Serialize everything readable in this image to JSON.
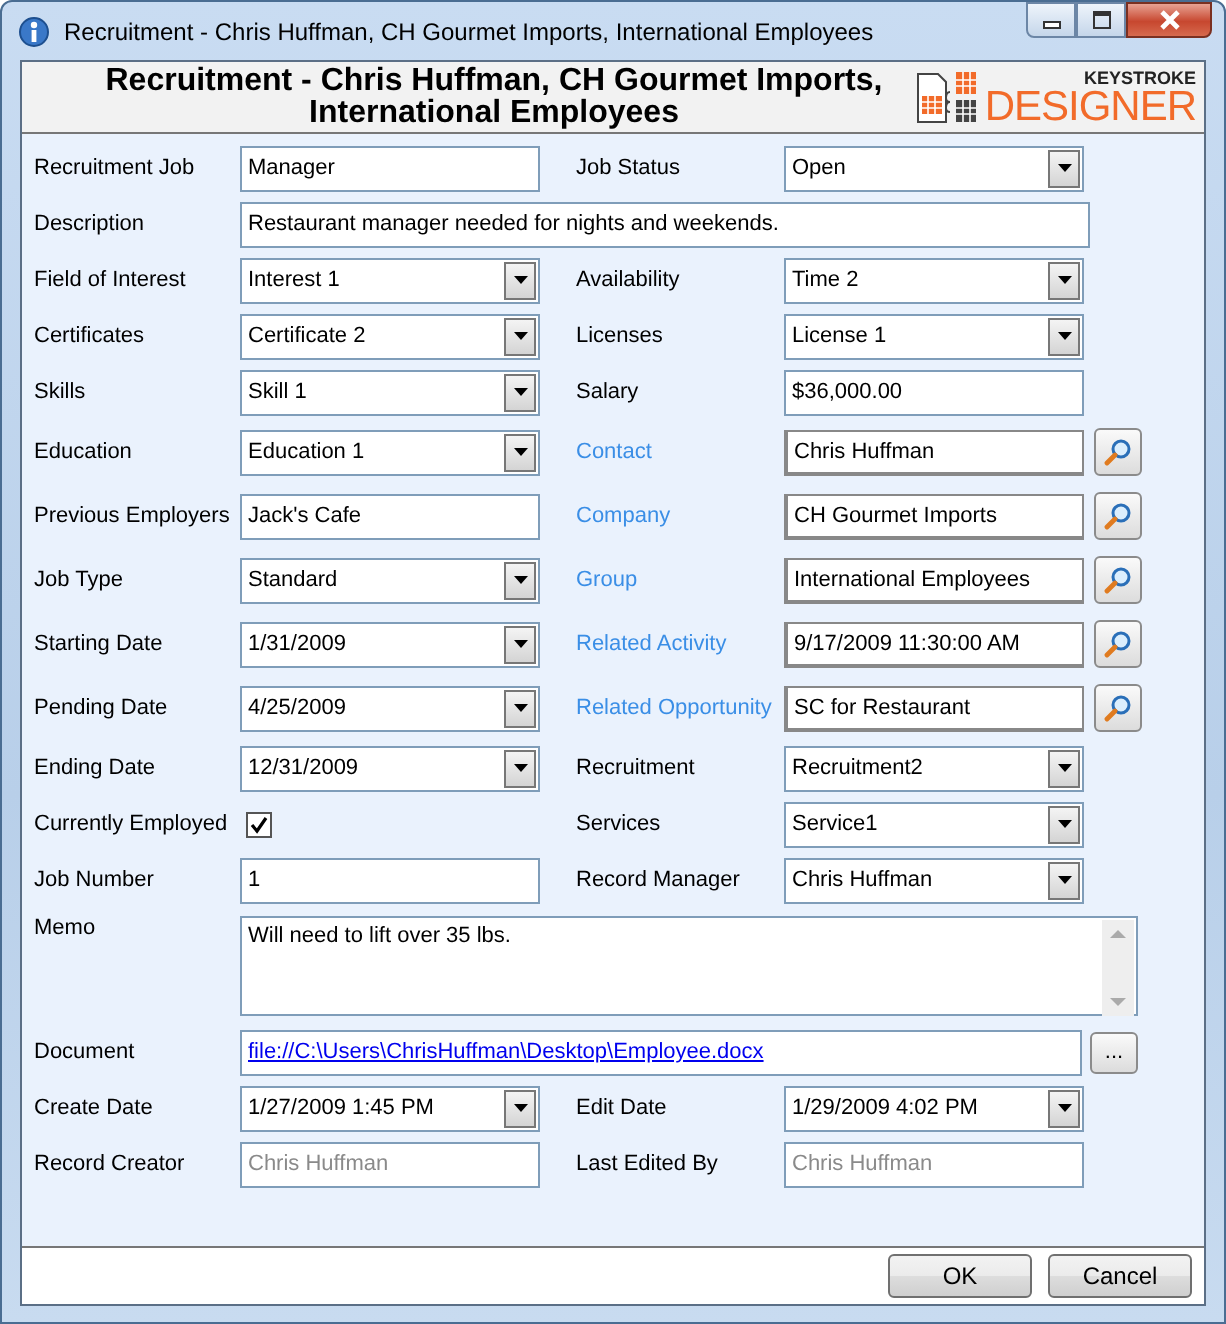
{
  "window": {
    "title": "Recruitment - Chris Huffman, CH Gourmet Imports, International Employees"
  },
  "header": {
    "title": "Recruitment - Chris Huffman, CH Gourmet Imports, International Employees",
    "logo_top": "KEYSTROKE",
    "logo_bottom": "DESIGNER"
  },
  "rows": [
    {
      "fields": [
        {
          "label": "Recruitment Job",
          "kind": "text",
          "value": "Manager"
        },
        {
          "label": "Job Status",
          "kind": "combo",
          "value": "Open"
        }
      ]
    },
    {
      "fields": [
        {
          "label": "Description",
          "kind": "text",
          "value": "Restaurant manager needed for nights and weekends."
        }
      ]
    },
    {
      "fields": [
        {
          "label": "Field of Interest",
          "kind": "combo",
          "value": "Interest 1"
        },
        {
          "label": "Availability",
          "kind": "combo",
          "value": "Time 2"
        }
      ]
    },
    {
      "fields": [
        {
          "label": "Certificates",
          "kind": "combo",
          "value": "Certificate 2"
        },
        {
          "label": "Licenses",
          "kind": "combo",
          "value": "License 1"
        }
      ]
    },
    {
      "fields": [
        {
          "label": "Skills",
          "kind": "combo",
          "value": "Skill 1"
        },
        {
          "label": "Salary",
          "kind": "text",
          "value": "$36,000.00"
        }
      ]
    },
    {
      "fields": [
        {
          "label": "Education",
          "kind": "combo",
          "value": "Education 1"
        },
        {
          "label": "Contact",
          "kind": "lookup",
          "value": "Chris Huffman"
        }
      ]
    },
    {
      "fields": [
        {
          "label": "Previous Employers",
          "kind": "text",
          "value": "Jack's Cafe"
        },
        {
          "label": "Company",
          "kind": "lookup",
          "value": "CH Gourmet Imports"
        }
      ]
    },
    {
      "fields": [
        {
          "label": "Job Type",
          "kind": "combo",
          "value": "Standard"
        },
        {
          "label": "Group",
          "kind": "lookup",
          "value": "International Employees"
        }
      ]
    },
    {
      "fields": [
        {
          "label": "Starting Date",
          "kind": "combo",
          "value": "1/31/2009"
        },
        {
          "label": "Related Activity",
          "kind": "lookup",
          "value": "9/17/2009 11:30:00 AM"
        }
      ]
    },
    {
      "fields": [
        {
          "label": "Pending Date",
          "kind": "combo",
          "value": "4/25/2009"
        },
        {
          "label": "Related Opportunity",
          "kind": "lookup",
          "value": "SC for Restaurant"
        }
      ]
    },
    {
      "fields": [
        {
          "label": "Ending Date",
          "kind": "combo",
          "value": "12/31/2009"
        },
        {
          "label": "Recruitment",
          "kind": "combo",
          "value": "Recruitment2"
        }
      ]
    },
    {
      "fields": [
        {
          "label": "Currently Employed",
          "kind": "check",
          "checked": true
        },
        {
          "label": "Services",
          "kind": "combo",
          "value": "Service1"
        }
      ]
    },
    {
      "fields": [
        {
          "label": "Job Number",
          "kind": "text",
          "value": "1"
        },
        {
          "label": "Record Manager",
          "kind": "combo",
          "value": "Chris Huffman"
        }
      ]
    },
    {
      "fields": [
        {
          "label": "Memo",
          "kind": "memo",
          "value": "Will need to lift over 35 lbs."
        }
      ]
    },
    {
      "fields": [
        {
          "label": "Document",
          "kind": "link",
          "value": "file://C:\\Users\\ChrisHuffman\\Desktop\\Employee.docx",
          "button": "..."
        }
      ]
    },
    {
      "fields": [
        {
          "label": "Create Date",
          "kind": "combo",
          "value": "1/27/2009 1:45 PM"
        },
        {
          "label": "Edit Date",
          "kind": "combo",
          "value": "1/29/2009 4:02 PM"
        }
      ]
    },
    {
      "fields": [
        {
          "label": "Record Creator",
          "kind": "readonly",
          "value": "Chris Huffman"
        },
        {
          "label": "Last Edited By",
          "kind": "readonly",
          "value": "Chris Huffman"
        }
      ]
    }
  ],
  "buttons": [
    "OK",
    "Cancel"
  ]
}
